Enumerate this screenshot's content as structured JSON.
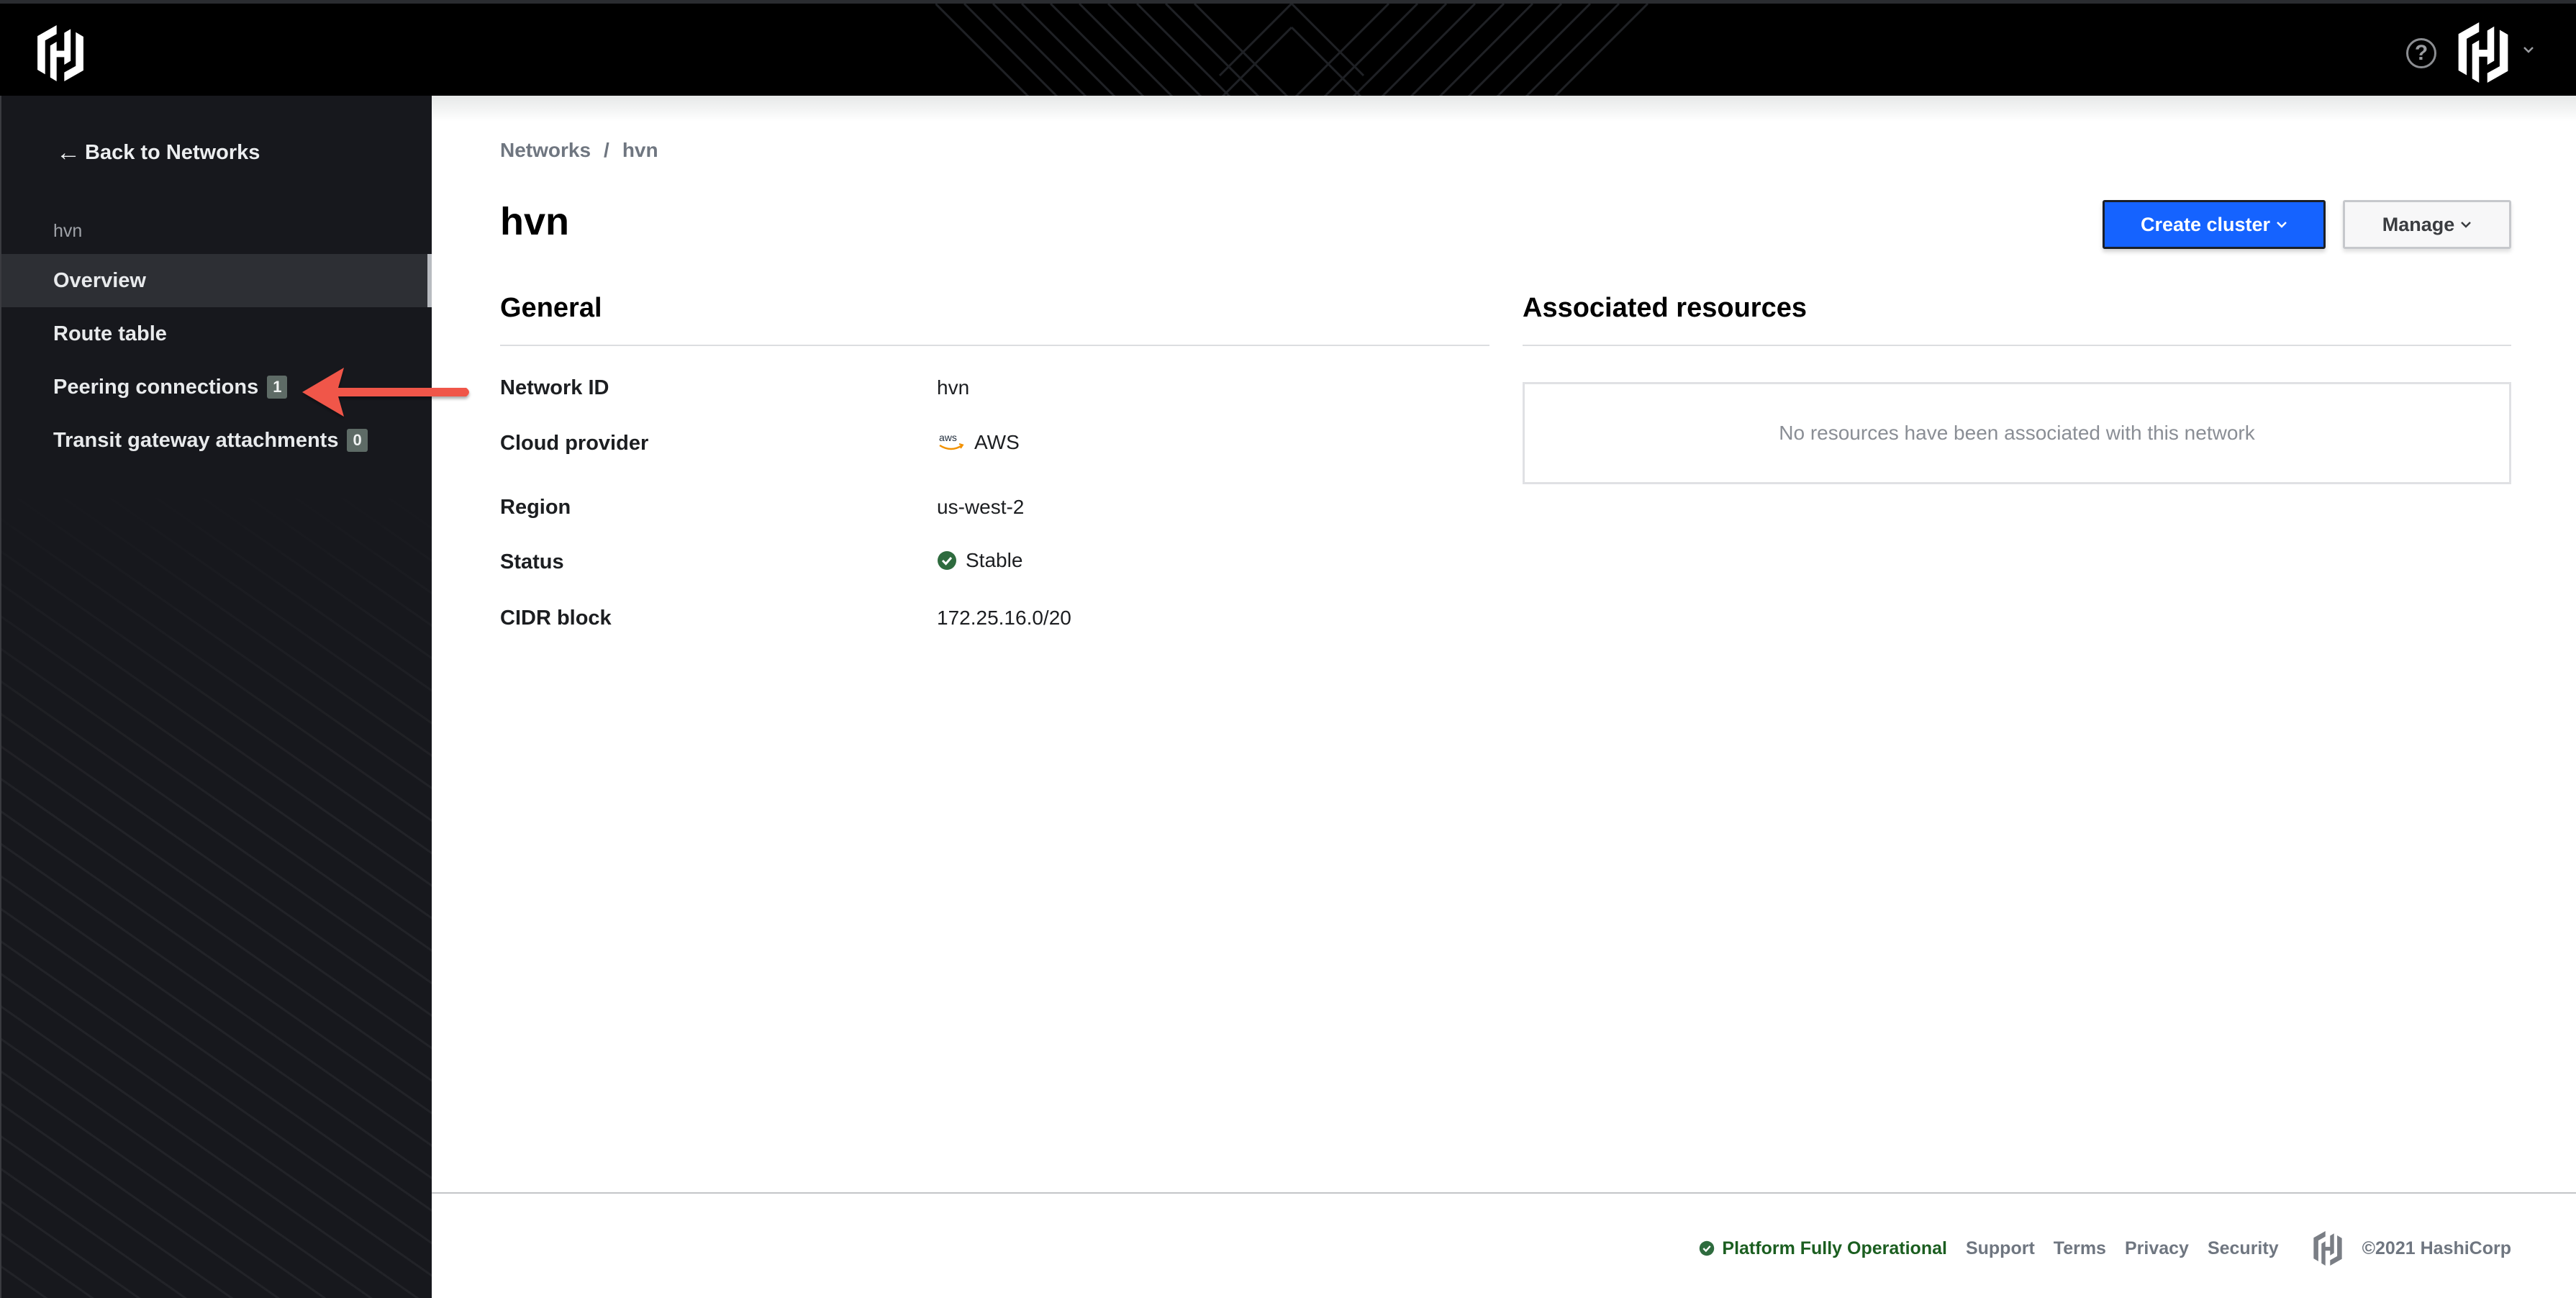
{
  "header": {
    "logo_icon": "hashicorp-logo-icon",
    "help_icon": "help-circle-icon",
    "org_icon": "organization-logo-icon",
    "help_glyph": "?"
  },
  "sidebar": {
    "back_label": "Back to Networks",
    "back_arrow": "←",
    "section_label": "hvn",
    "items": [
      {
        "label": "Overview",
        "active": true
      },
      {
        "label": "Route table"
      },
      {
        "label": "Peering connections",
        "badge": "1"
      },
      {
        "label": "Transit gateway attachments",
        "badge": "0"
      }
    ]
  },
  "annotation": {
    "arrow_color": "#f0574a",
    "target": "Peering connections"
  },
  "breadcrumb": {
    "items": [
      "Networks",
      "hvn"
    ],
    "separator": "/"
  },
  "page": {
    "title": "hvn"
  },
  "actions": {
    "primary_label": "Create cluster",
    "secondary_label": "Manage",
    "chevron": "⌄"
  },
  "general": {
    "title": "General",
    "fields": [
      {
        "label": "Network ID",
        "value": "hvn"
      },
      {
        "label": "Cloud provider",
        "value": "AWS",
        "icon": "aws-logo-icon"
      },
      {
        "label": "Region",
        "value": "us-west-2"
      },
      {
        "label": "Status",
        "value": "Stable",
        "icon": "check-circle-icon"
      },
      {
        "label": "CIDR block",
        "value": "172.25.16.0/20"
      }
    ]
  },
  "associated": {
    "title": "Associated resources",
    "empty_message": "No resources have been associated with this network"
  },
  "footer": {
    "status": "Platform Fully Operational",
    "links": [
      "Support",
      "Terms",
      "Privacy",
      "Security"
    ],
    "copyright": "©2021 HashiCorp"
  },
  "colors": {
    "primary": "#1563ff",
    "sidebar_bg": "#17181d",
    "status_green": "#1b5e20",
    "aws_orange": "#f29100"
  }
}
